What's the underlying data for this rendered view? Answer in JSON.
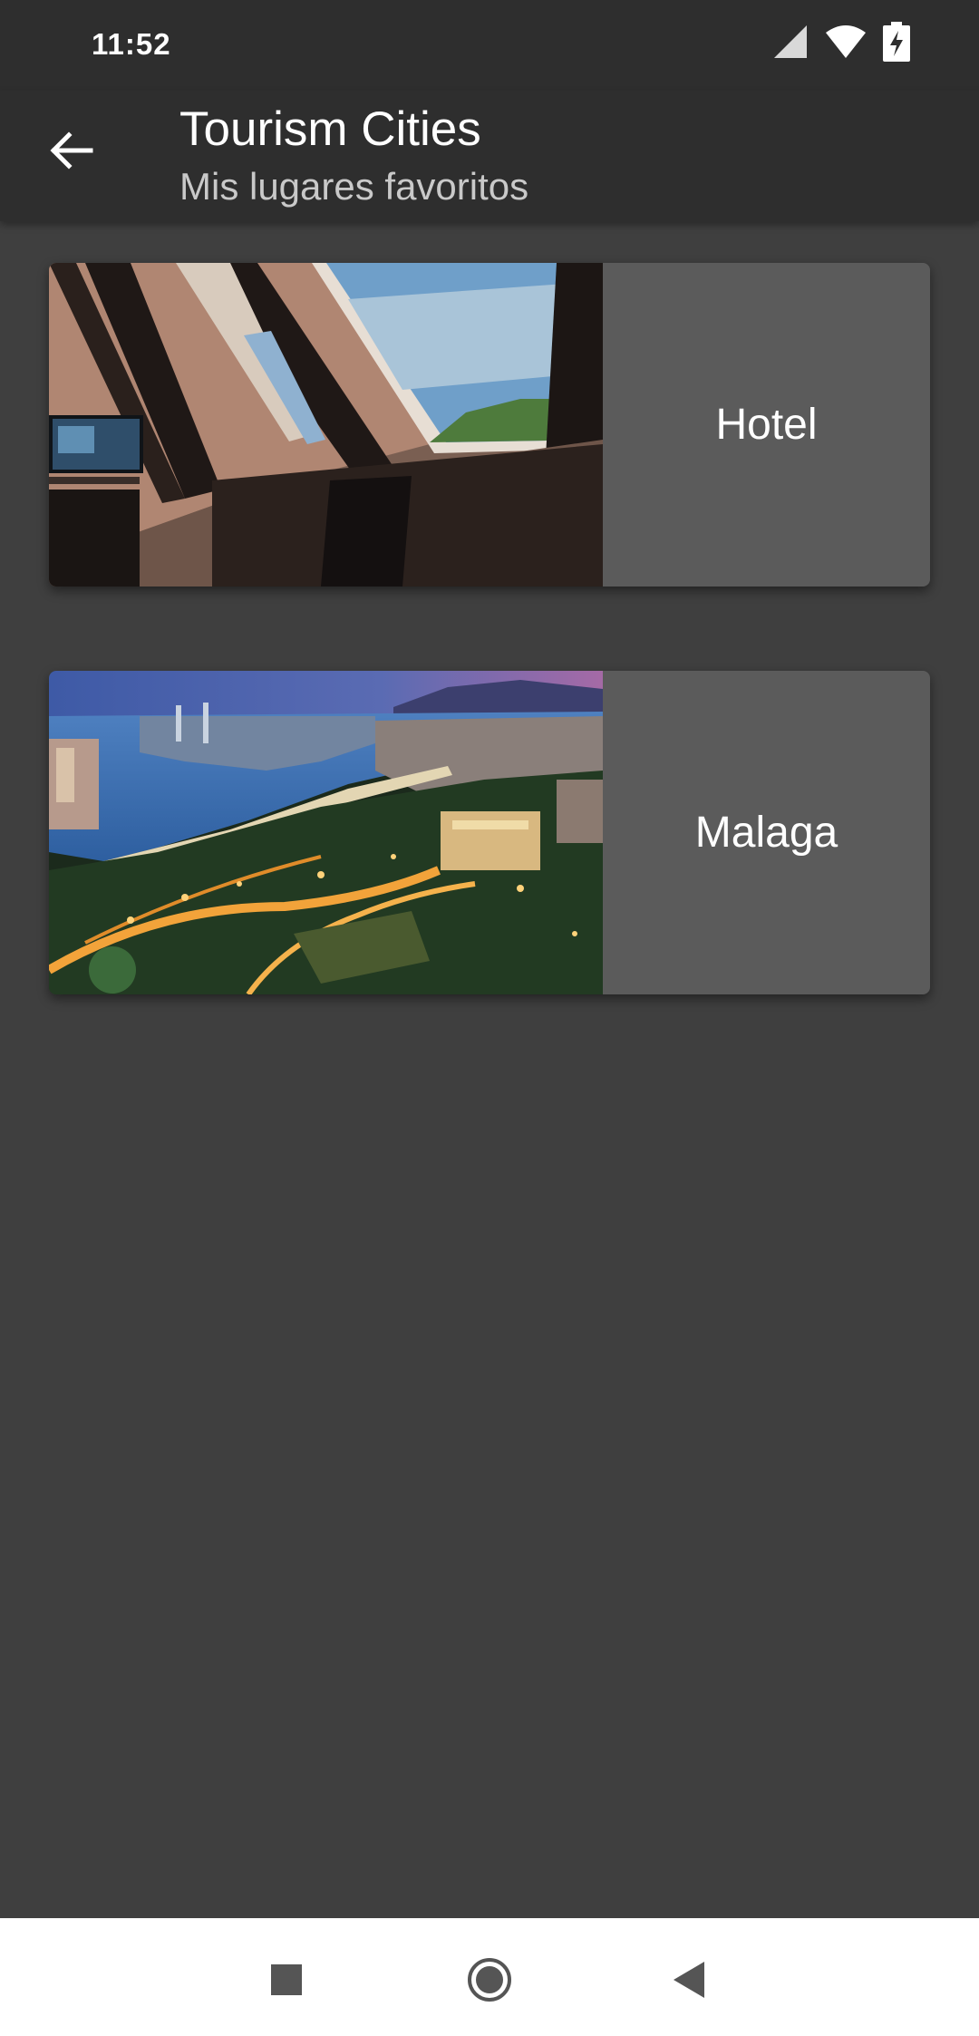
{
  "status_bar": {
    "time": "11:52",
    "icons": [
      "cell-signal-icon",
      "wifi-icon",
      "battery-charging-icon"
    ]
  },
  "app_bar": {
    "back_icon": "arrow-back-icon",
    "title": "Tourism Cities",
    "subtitle": "Mis lugares favoritos"
  },
  "places": [
    {
      "name": "Hotel",
      "image": "hotel-room-skylight-photo"
    },
    {
      "name": "Malaga",
      "image": "malaga-night-cityscape-photo"
    }
  ],
  "nav_bar": {
    "buttons": [
      "recents-square-icon",
      "home-circle-icon",
      "back-triangle-icon"
    ]
  },
  "colors": {
    "background": "#3f3f3f",
    "app_bar": "#2e2e2e",
    "card_label_bg": "#5b5b5b",
    "nav_bar": "#ffffff"
  }
}
